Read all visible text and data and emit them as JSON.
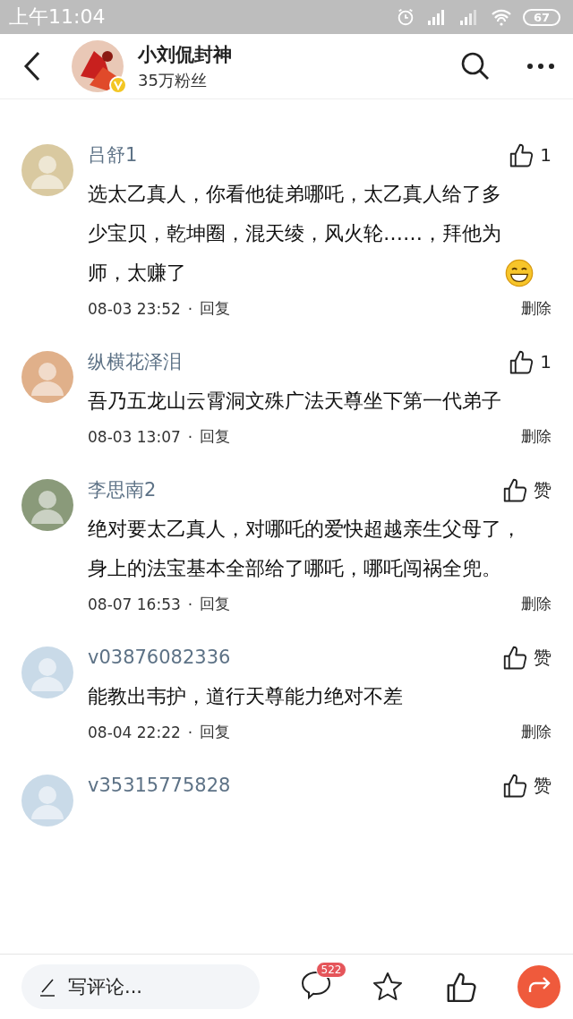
{
  "status_bar": {
    "time": "上午11:04",
    "battery": "67"
  },
  "header": {
    "title": "小刘侃封神",
    "subtitle": "35万粉丝",
    "verified": true
  },
  "comments": [
    {
      "name": "吕舒1",
      "text": "选太乙真人，你看他徒弟哪吒，太乙真人给了多少宝贝，乾坤圈，混天绫，风火轮……，拜他为师，太赚了",
      "emoji": true,
      "likes": "1",
      "time": "08-03 23:52",
      "separator": "·",
      "reply": "回复",
      "delete": "删除"
    },
    {
      "name": "纵横花泽泪",
      "text": "吾乃五龙山云霄洞文殊广法天尊坐下第一代弟子",
      "emoji": false,
      "likes": "1",
      "time": "08-03 13:07",
      "separator": "·",
      "reply": "回复",
      "delete": "删除"
    },
    {
      "name": "李思南2",
      "text": "绝对要太乙真人，对哪吒的爱快超越亲生父母了，身上的法宝基本全部给了哪吒，哪吒闯祸全兜。",
      "emoji": false,
      "likes": "赞",
      "time": "08-07 16:53",
      "separator": "·",
      "reply": "回复",
      "delete": "删除"
    },
    {
      "name": "v03876082336",
      "text": "能教出韦护，道行天尊能力绝对不差",
      "emoji": false,
      "likes": "赞",
      "time": "08-04 22:22",
      "separator": "·",
      "reply": "回复",
      "delete": "删除"
    },
    {
      "name": "v35315775828",
      "likes": "赞"
    }
  ],
  "bottom_bar": {
    "placeholder": "写评论...",
    "comment_count": "522"
  }
}
